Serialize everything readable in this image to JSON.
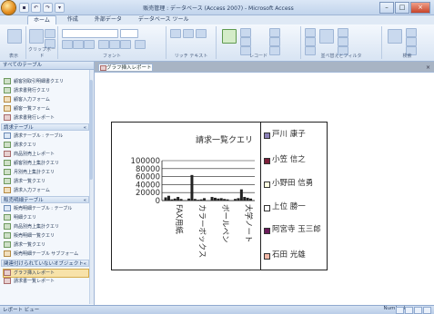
{
  "window": {
    "title": "販売管理 : データベース (Access 2007) - Microsoft Access"
  },
  "ribbon": {
    "tabs": [
      "ホーム",
      "作成",
      "外部データ",
      "データベース ツール"
    ],
    "active_tab": "ホーム",
    "groups": [
      "表示",
      "クリップボード",
      "フォント",
      "リッチ テキスト",
      "レコード",
      "並べ替えとフィルタ",
      "検索"
    ]
  },
  "nav": {
    "header": "すべてのテーブル",
    "groups": [
      {
        "label": "請求テーブル",
        "top": 0
      },
      {
        "label": "販売明細テーブル",
        "top": 0
      },
      {
        "label": "関連付けられていないオブジェクト",
        "top": 0
      }
    ],
    "items": [
      "顧客別取引明細書クエリ",
      "請求書発行クエリ",
      "顧客入力フォーム",
      "顧客一覧フォーム",
      "請求書発行レポート",
      "請求テーブル : テーブル",
      "請求クエリ",
      "商品別売上レポート",
      "顧客別売上集計クエリ",
      "月別売上集計クエリ",
      "請求一覧クエリ",
      "請求入力フォーム",
      "販売明細テーブル : テーブル",
      "明細クエリ",
      "商品別売上集計クエリ",
      "販売明細一覧クエリ",
      "請求一覧クエリ",
      "販売明細テーブル サブフォーム",
      "グラフ挿入レポート",
      "請求書一覧レポート"
    ]
  },
  "document": {
    "tab_label": "グラフ挿入レポート",
    "close_glyph": "×"
  },
  "chart_data": {
    "type": "bar",
    "title": "請求一覧クエリ",
    "ylim": [
      0,
      100000
    ],
    "yticks": [
      "100000",
      "80000",
      "60000",
      "40000",
      "20000",
      "0"
    ],
    "categories": [
      "FAX用紙",
      "カラーボックス",
      "ボールペン",
      "大学ノート"
    ],
    "series": [
      {
        "name": "戸川 康子",
        "color": "#8a7fb6",
        "values": [
          8000,
          5000,
          9000,
          4000
        ]
      },
      {
        "name": "小笠 信之",
        "color": "#7d1f3a",
        "values": [
          12000,
          64000,
          7000,
          6000
        ]
      },
      {
        "name": "小野田 信勇",
        "color": "#ffffe0",
        "values": [
          3000,
          4000,
          5000,
          28000
        ]
      },
      {
        "name": "上位 勝一",
        "color": "#ffffff",
        "values": [
          5000,
          2000,
          6000,
          9000
        ]
      },
      {
        "name": "阿宮寺 玉三郎",
        "color": "#6a1a5a",
        "values": [
          9000,
          3000,
          4000,
          7000
        ]
      },
      {
        "name": "石田 光雄",
        "color": "#f2b8a8",
        "values": [
          4000,
          6000,
          3000,
          5000
        ]
      }
    ],
    "legend": "right",
    "grid": true
  },
  "status": {
    "left": "レポート ビュー",
    "right": "NumLock"
  }
}
